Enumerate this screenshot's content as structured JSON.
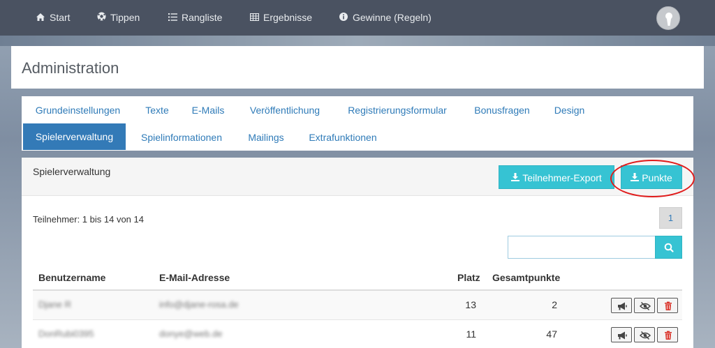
{
  "nav": {
    "items": [
      {
        "label": "Start",
        "icon": "home-icon"
      },
      {
        "label": "Tippen",
        "icon": "soccer-ball-icon"
      },
      {
        "label": "Rangliste",
        "icon": "list-icon"
      },
      {
        "label": "Ergebnisse",
        "icon": "table-icon"
      },
      {
        "label": "Gewinne (Regeln)",
        "icon": "info-icon"
      }
    ],
    "avatar_icon": "user-avatar-icon"
  },
  "page": {
    "title": "Administration"
  },
  "tabs": {
    "row1": [
      "Grundeinstellungen",
      "Texte",
      "E-Mails",
      "Veröffentlichung",
      "Registrierungsformular",
      "Bonusfragen",
      "Design"
    ],
    "row2": [
      "Spielerverwaltung",
      "Spielinformationen",
      "Mailings",
      "Extrafunktionen"
    ],
    "active": "Spielerverwaltung"
  },
  "panel": {
    "title": "Spielerverwaltung",
    "export_button": "Teilnehmer-Export",
    "points_button": "Punkte",
    "count_text": "Teilnehmer: 1 bis 14 von 14",
    "current_page": "1",
    "search": {
      "value": "",
      "placeholder": ""
    }
  },
  "table": {
    "headers": [
      "Benutzername",
      "E-Mail-Adresse",
      "Platz",
      "Gesamtpunkte"
    ],
    "rows": [
      {
        "username": "Djane R",
        "email": "info@djane-rosa.de",
        "place": "13",
        "points": "2"
      },
      {
        "username": "DonRubi0395",
        "email": "donye@web.de",
        "place": "11",
        "points": "47"
      }
    ],
    "action_icons": [
      "megaphone-icon",
      "eye-slash-icon",
      "trash-icon"
    ]
  },
  "colors": {
    "navbar": "#4a5261",
    "link": "#2f7bb8",
    "active_tab": "#337ab7",
    "info_button": "#36c3d3",
    "highlight": "#e01b1b",
    "delete": "#d9342b"
  }
}
